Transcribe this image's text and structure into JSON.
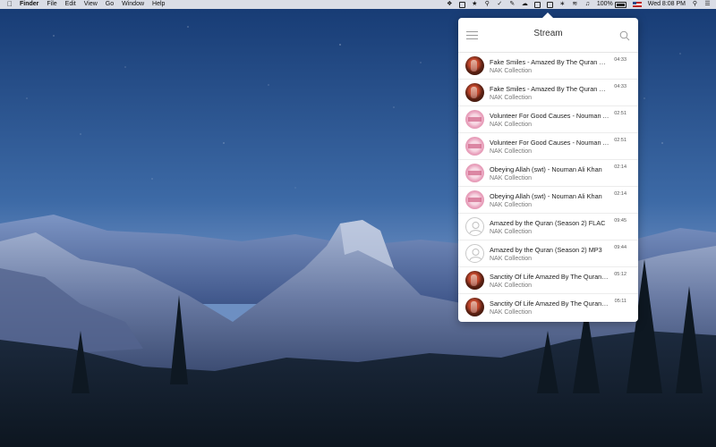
{
  "menubar": {
    "app_name": "Finder",
    "menus": [
      "File",
      "Edit",
      "View",
      "Go",
      "Window",
      "Help"
    ],
    "battery": "100%",
    "clock": "Wed 8:08 PM"
  },
  "panel": {
    "title": "Stream",
    "tracks": [
      {
        "title": "Fake Smiles - Amazed By The Quran With Nouman Ali Khan",
        "collection": "NAK Collection",
        "duration": "04:33",
        "art": "dark"
      },
      {
        "title": "Fake Smiles - Amazed By The Quran With Nouman Ali Khan",
        "collection": "NAK Collection",
        "duration": "04:33",
        "art": "dark"
      },
      {
        "title": "Volunteer For Good Causes - Nouman Ali Khan",
        "collection": "NAK Collection",
        "duration": "02:51",
        "art": "pink"
      },
      {
        "title": "Volunteer For Good Causes - Nouman Ali Khan",
        "collection": "NAK Collection",
        "duration": "02:51",
        "art": "pink"
      },
      {
        "title": "Obeying Allah (swt) - Nouman Ali Khan",
        "collection": "NAK Collection",
        "duration": "02:14",
        "art": "pink"
      },
      {
        "title": "Obeying Allah (swt) - Nouman Ali Khan",
        "collection": "NAK Collection",
        "duration": "02:14",
        "art": "pink"
      },
      {
        "title": "Amazed by the Quran (Season 2) FLAC",
        "collection": "NAK Collection",
        "duration": "09:45",
        "art": "placeholder"
      },
      {
        "title": "Amazed by the Quran (Season 2) MP3",
        "collection": "NAK Collection",
        "duration": "09:44",
        "art": "placeholder"
      },
      {
        "title": "Sanctity Of Life  Amazed By The Quran With Nouman Ali Khan",
        "collection": "NAK Collection",
        "duration": "05:12",
        "art": "dark"
      },
      {
        "title": "Sanctity Of Life  Amazed By The Quran With Nouman Ali Khan",
        "collection": "NAK Collection",
        "duration": "05:11",
        "art": "dark"
      }
    ]
  }
}
